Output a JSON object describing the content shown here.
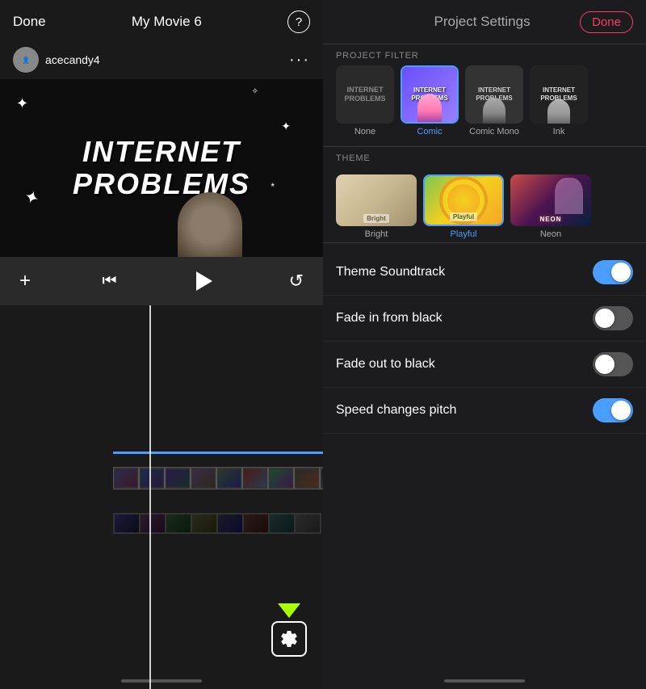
{
  "left": {
    "done_label": "Done",
    "title": "My Movie 6",
    "question_icon": "?",
    "username": "acecandy4",
    "ellipsis": "···",
    "video_title_line1": "INTERNET",
    "video_title_line2": "PROBLEMS",
    "controls": {
      "add": "+",
      "skip_back": "⏮",
      "play": "▶",
      "rotate": "↺"
    },
    "settings_label": "settings-icon"
  },
  "right": {
    "title": "Project Settings",
    "done_label": "Done",
    "sections": {
      "filter": {
        "label": "PROJECT FILTER",
        "items": [
          {
            "id": "none",
            "label": "None",
            "selected": false
          },
          {
            "id": "comic",
            "label": "Comic",
            "selected": true
          },
          {
            "id": "comic_mono",
            "label": "Comic Mono",
            "selected": false
          },
          {
            "id": "ink",
            "label": "Ink",
            "selected": false
          }
        ]
      },
      "theme": {
        "label": "THEME",
        "items": [
          {
            "id": "bright",
            "label": "Bright",
            "selected": false
          },
          {
            "id": "playful",
            "label": "Playful",
            "selected": true
          },
          {
            "id": "neon",
            "label": "Neon",
            "selected": false
          }
        ]
      }
    },
    "toggles": [
      {
        "id": "theme_soundtrack",
        "label": "Theme Soundtrack",
        "on": true
      },
      {
        "id": "fade_in",
        "label": "Fade in from black",
        "on": false
      },
      {
        "id": "fade_out",
        "label": "Fade out to black",
        "on": false
      },
      {
        "id": "speed_pitch",
        "label": "Speed changes pitch",
        "on": true
      }
    ]
  }
}
